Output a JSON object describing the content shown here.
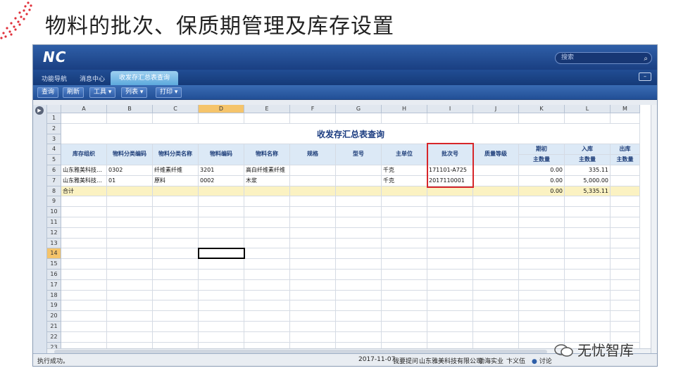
{
  "slide": {
    "title": "物料的批次、保质期管理及库存设置"
  },
  "app": {
    "logo": "NC",
    "search_placeholder": "搜索",
    "tabs": [
      {
        "label": "功能导航"
      },
      {
        "label": "消息中心"
      },
      {
        "label": "收发存汇总表查询",
        "active": true
      }
    ],
    "toolbar": {
      "query": "查询",
      "refresh": "刷新",
      "tools": "工具",
      "list": "列表",
      "print": "打印"
    }
  },
  "sheet": {
    "columns": [
      "A",
      "B",
      "C",
      "D",
      "E",
      "F",
      "G",
      "H",
      "I",
      "J",
      "K",
      "L",
      "M"
    ],
    "selected_column": "D",
    "selected_row": "14",
    "row_numbers": [
      "1",
      "2",
      "3",
      "4",
      "5",
      "6",
      "7",
      "8",
      "9",
      "10",
      "11",
      "12",
      "13",
      "14",
      "15",
      "16",
      "17",
      "18",
      "19",
      "20",
      "21",
      "22",
      "23"
    ],
    "report_title": "收发存汇总表查询",
    "headers": [
      "库存组织",
      "物料分类编码",
      "物料分类名称",
      "物料编码",
      "物料名称",
      "规格",
      "型号",
      "主单位",
      "批次号",
      "质量等级"
    ],
    "group_headers": {
      "opening": "期初",
      "inbound": "入库",
      "outbound": "出库"
    },
    "sub_headers": {
      "opening": "主数量",
      "inbound": "主数量",
      "outbound": "主数量"
    },
    "rows": [
      {
        "org": "山东雅美科技…",
        "cat_code": "0302",
        "cat_name": "纤维素纤维",
        "code": "3201",
        "name": "高白纤维素纤维",
        "spec": "",
        "model": "",
        "unit": "千克",
        "batch": "171101-A725",
        "grade": "",
        "opening": "0.00",
        "inbound": "335.11",
        "outbound": ""
      },
      {
        "org": "山东雅美科技…",
        "cat_code": "01",
        "cat_name": "原料",
        "code": "0002",
        "name": "木浆",
        "spec": "",
        "model": "",
        "unit": "千克",
        "batch": "2017110001",
        "grade": "",
        "opening": "0.00",
        "inbound": "5,000.00",
        "outbound": ""
      }
    ],
    "total": {
      "label": "合计",
      "opening": "0.00",
      "inbound": "5,335.11"
    }
  },
  "status_bar": {
    "message": "执行成功。",
    "date": "2017-11-07",
    "feedback": "我要提问",
    "company": "山东雅美科技有限公司",
    "group": "渤海实业",
    "user": "卞义伍",
    "discuss": "讨论"
  },
  "watermark": "无忧智库",
  "colors": {
    "highlight_box": "#d7262a",
    "header_blue": "#2f5fa8",
    "total_row": "#fbf2c2"
  }
}
